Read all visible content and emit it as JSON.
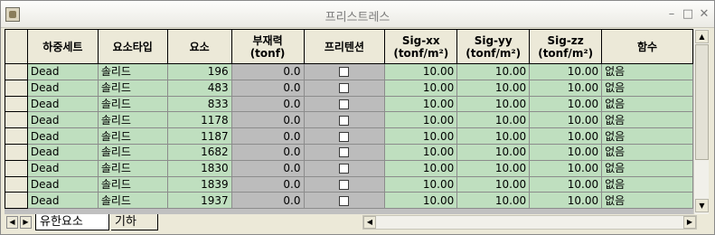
{
  "window": {
    "title": "프리스트레스",
    "minimize_glyph": "–",
    "maximize_glyph": "□",
    "close_glyph": "✕"
  },
  "table": {
    "columns": [
      {
        "key": "load_set",
        "label": "하중세트"
      },
      {
        "key": "element_type",
        "label": "요소타입"
      },
      {
        "key": "element",
        "label": "요소"
      },
      {
        "key": "member_force",
        "label": "부재력\n(tonf)"
      },
      {
        "key": "pre_tension",
        "label": "프리텐션"
      },
      {
        "key": "sig_xx",
        "label": "Sig-xx\n(tonf/m²)"
      },
      {
        "key": "sig_yy",
        "label": "Sig-yy\n(tonf/m²)"
      },
      {
        "key": "sig_zz",
        "label": "Sig-zz\n(tonf/m²)"
      },
      {
        "key": "function",
        "label": "함수"
      }
    ],
    "rows": [
      {
        "load_set": "Dead",
        "element_type": "솔리드",
        "element": "196",
        "member_force": "0.0",
        "pre_tension": false,
        "sig_xx": "10.00",
        "sig_yy": "10.00",
        "sig_zz": "10.00",
        "function": "없음"
      },
      {
        "load_set": "Dead",
        "element_type": "솔리드",
        "element": "483",
        "member_force": "0.0",
        "pre_tension": false,
        "sig_xx": "10.00",
        "sig_yy": "10.00",
        "sig_zz": "10.00",
        "function": "없음"
      },
      {
        "load_set": "Dead",
        "element_type": "솔리드",
        "element": "833",
        "member_force": "0.0",
        "pre_tension": false,
        "sig_xx": "10.00",
        "sig_yy": "10.00",
        "sig_zz": "10.00",
        "function": "없음"
      },
      {
        "load_set": "Dead",
        "element_type": "솔리드",
        "element": "1178",
        "member_force": "0.0",
        "pre_tension": false,
        "sig_xx": "10.00",
        "sig_yy": "10.00",
        "sig_zz": "10.00",
        "function": "없음"
      },
      {
        "load_set": "Dead",
        "element_type": "솔리드",
        "element": "1187",
        "member_force": "0.0",
        "pre_tension": false,
        "sig_xx": "10.00",
        "sig_yy": "10.00",
        "sig_zz": "10.00",
        "function": "없음"
      },
      {
        "load_set": "Dead",
        "element_type": "솔리드",
        "element": "1682",
        "member_force": "0.0",
        "pre_tension": false,
        "sig_xx": "10.00",
        "sig_yy": "10.00",
        "sig_zz": "10.00",
        "function": "없음"
      },
      {
        "load_set": "Dead",
        "element_type": "솔리드",
        "element": "1830",
        "member_force": "0.0",
        "pre_tension": false,
        "sig_xx": "10.00",
        "sig_yy": "10.00",
        "sig_zz": "10.00",
        "function": "없음"
      },
      {
        "load_set": "Dead",
        "element_type": "솔리드",
        "element": "1839",
        "member_force": "0.0",
        "pre_tension": false,
        "sig_xx": "10.00",
        "sig_yy": "10.00",
        "sig_zz": "10.00",
        "function": "없음"
      },
      {
        "load_set": "Dead",
        "element_type": "솔리드",
        "element": "1937",
        "member_force": "0.0",
        "pre_tension": false,
        "sig_xx": "10.00",
        "sig_yy": "10.00",
        "sig_zz": "10.00",
        "function": "없음"
      }
    ]
  },
  "tabs": [
    {
      "label": "유한요소",
      "active": true
    },
    {
      "label": "기하",
      "active": false
    }
  ],
  "colors": {
    "editable_cell": "#bfdfbf",
    "readonly_cell": "#bcbcbc",
    "header": "#ece9d8"
  },
  "icons": {
    "scroll_up": "scroll-up-arrow-icon",
    "scroll_down": "scroll-down-arrow-icon",
    "scroll_left": "scroll-left-arrow-icon",
    "scroll_right": "scroll-right-arrow-icon"
  }
}
